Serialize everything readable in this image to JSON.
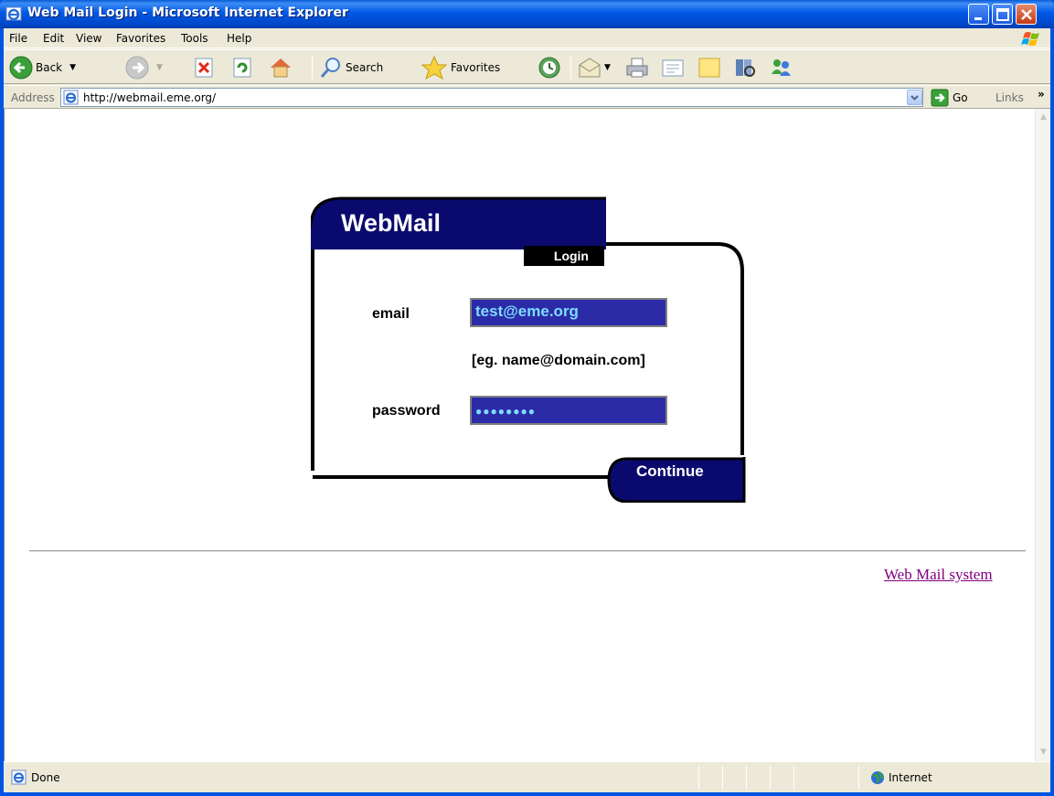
{
  "window": {
    "title": "Web Mail Login - Microsoft Internet Explorer"
  },
  "menu": [
    "File",
    "Edit",
    "View",
    "Favorites",
    "Tools",
    "Help"
  ],
  "toolbar": {
    "back_label": "Back",
    "search_label": "Search",
    "favorites_label": "Favorites"
  },
  "address": {
    "label": "Address",
    "url": "http://webmail.eme.org/",
    "go_label": "Go",
    "links_label": "Links",
    "more_chevron": "»"
  },
  "login": {
    "brand": "WebMail",
    "tag": "Login",
    "email_label": "email",
    "email_value": "test@eme.org",
    "hint": "[eg. name@domain.com]",
    "password_label": "password",
    "password_value": "●●●●●●●●",
    "continue_label": "Continue"
  },
  "footer": {
    "link_text": "Web Mail system"
  },
  "status": {
    "text": "Done",
    "zone": "Internet"
  },
  "colors": {
    "titlebar": "#0058e6",
    "panel_navy": "#0a0a6e",
    "input_fill": "#2b2ba8",
    "input_text": "#7fdcff",
    "link_visited": "#800080"
  }
}
